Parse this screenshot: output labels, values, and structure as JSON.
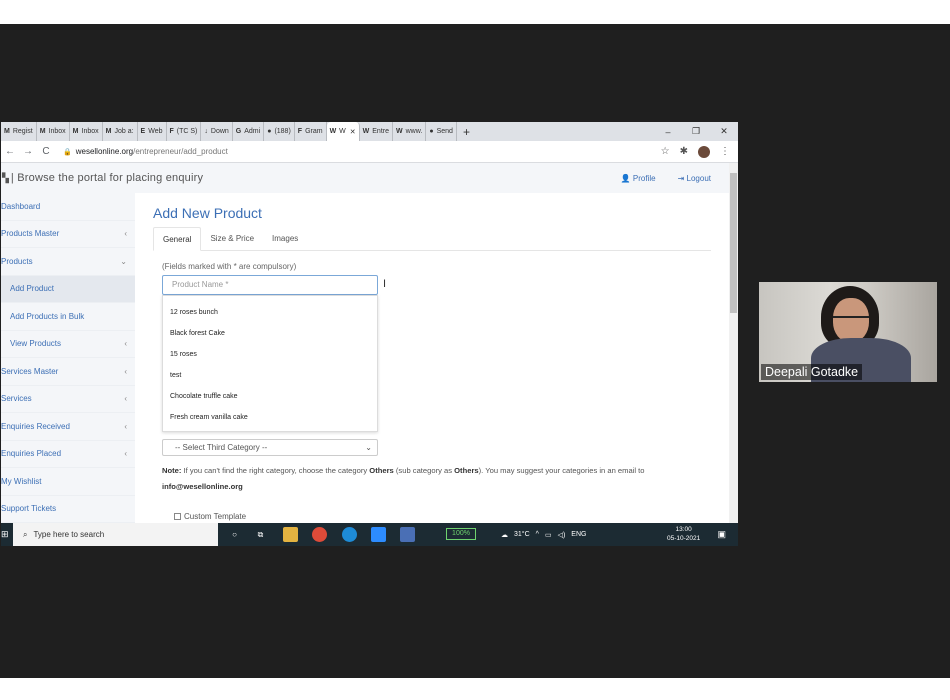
{
  "browser": {
    "tabs": [
      {
        "favicon": "M",
        "label": "Regist"
      },
      {
        "favicon": "M",
        "label": "Inbox"
      },
      {
        "favicon": "M",
        "label": "Inbox"
      },
      {
        "favicon": "M",
        "label": "Job a:"
      },
      {
        "favicon": "E",
        "label": "Web"
      },
      {
        "favicon": "F",
        "label": "(TC S)"
      },
      {
        "favicon": "↓",
        "label": "Down"
      },
      {
        "favicon": "G",
        "label": "Admi"
      },
      {
        "favicon": "●",
        "label": "(188)"
      },
      {
        "favicon": "F",
        "label": "Gram"
      },
      {
        "favicon": "W",
        "label": "W"
      },
      {
        "favicon": "W",
        "label": "Entre"
      },
      {
        "favicon": "W",
        "label": "www."
      },
      {
        "favicon": "●",
        "label": "Send"
      }
    ],
    "url_host": "wesellonline.org",
    "url_path": "/entrepreneur/add_product",
    "icons": {
      "back": "arrow-left-icon",
      "forward": "arrow-right-icon",
      "reload": "reload-icon",
      "star": "star-icon",
      "extensions": "puzzle-icon",
      "menu": "kebab-menu-icon"
    }
  },
  "site": {
    "header_title": "| Browse the portal for placing enquiry",
    "profile_label": "Profile",
    "logout_label": "Logout"
  },
  "sidebar": {
    "items": [
      {
        "label": "Dashboard",
        "chevron": ""
      },
      {
        "label": "Products Master",
        "chevron": "‹"
      },
      {
        "label": "Products",
        "chevron": "⌄"
      },
      {
        "label": "Add Product",
        "chevron": ""
      },
      {
        "label": "Add Products in Bulk",
        "chevron": ""
      },
      {
        "label": "View Products",
        "chevron": "‹"
      },
      {
        "label": "Services Master",
        "chevron": "‹"
      },
      {
        "label": "Services",
        "chevron": "‹"
      },
      {
        "label": "Enquiries Received",
        "chevron": "‹"
      },
      {
        "label": "Enquiries Placed",
        "chevron": "‹"
      },
      {
        "label": "My Wishlist",
        "chevron": ""
      },
      {
        "label": "Support Tickets",
        "chevron": ""
      }
    ]
  },
  "form": {
    "title": "Add New Product",
    "tabs": [
      "General",
      "Size & Price",
      "Images"
    ],
    "hint": "(Fields marked with * are compulsory)",
    "product_name_placeholder": "Product Name *",
    "suggestions": [
      "12 roses bunch",
      "Black forest Cake",
      "15 roses",
      "test",
      "Chocolate truffle cake",
      "Fresh cream vanilla cake"
    ],
    "third_category": "-- Select Third Category --",
    "note_label": "Note:",
    "note_text_1": " If you can't find the right category, choose the category ",
    "note_others_1": "Others",
    "note_text_2": " (sub category as ",
    "note_others_2": "Others",
    "note_text_3": "). You may suggest your categories in an email to ",
    "note_email": "info@wesellonline.org",
    "custom_template_label": "Custom Template"
  },
  "taskbar": {
    "search_placeholder": "Type here to search",
    "battery": "100%",
    "weather": "31°C",
    "language": "ENG",
    "time": "13:00",
    "date": "05-10-2021"
  },
  "video": {
    "participant_name": "Deepali Gotadke"
  }
}
